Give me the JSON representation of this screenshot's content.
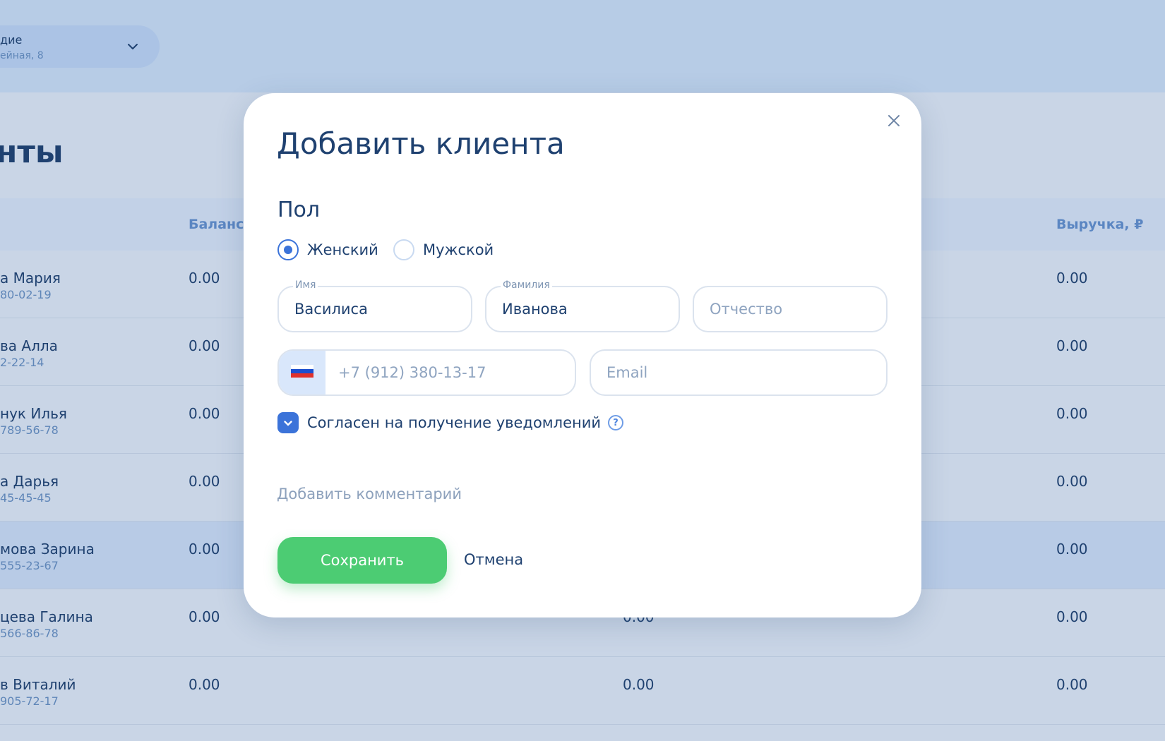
{
  "colors": {
    "accent": "#3b73d9",
    "success": "#4ccc73",
    "text_primary": "#1f4170",
    "text_muted": "#8fa4c0",
    "overlay_bg": "#c9d5e6"
  },
  "background": {
    "location": {
      "name": "дие",
      "address": "ейная, 8",
      "icon": "chevron-down-icon"
    },
    "page_title": "нты",
    "table": {
      "headers": {
        "balance": "Баланс",
        "revenue": "Выручка, ₽"
      },
      "rows": [
        {
          "name": "а Мария",
          "phone": "80-02-19",
          "balance": "0.00",
          "mid": "",
          "revenue": "0.00"
        },
        {
          "name": "ва Алла",
          "phone": "2-22-14",
          "balance": "0.00",
          "mid": "",
          "revenue": "0.00"
        },
        {
          "name": "нук Илья",
          "phone": "789-56-78",
          "balance": "0.00",
          "mid": "",
          "revenue": "0.00"
        },
        {
          "name": "а Дарья",
          "phone": "45-45-45",
          "balance": "0.00",
          "mid": "",
          "revenue": "0.00"
        },
        {
          "name": "мова Зарина",
          "phone": "555-23-67",
          "balance": "0.00",
          "mid": "",
          "revenue": "0.00"
        },
        {
          "name": "цева Галина",
          "phone": "566-86-78",
          "balance": "0.00",
          "mid": "0.00",
          "revenue": "0.00"
        },
        {
          "name": "в Виталий",
          "phone": "905-72-17",
          "balance": "0.00",
          "mid": "0.00",
          "revenue": "0.00"
        }
      ]
    }
  },
  "modal": {
    "title": "Добавить клиента",
    "close_icon": "close-icon",
    "gender": {
      "label": "Пол",
      "options": [
        {
          "label": "Женский",
          "checked": true
        },
        {
          "label": "Мужской",
          "checked": false
        }
      ]
    },
    "fields": {
      "first_name": {
        "label": "Имя",
        "value": "Василиса",
        "placeholder": ""
      },
      "last_name": {
        "label": "Фамилия",
        "value": "Иванова",
        "placeholder": ""
      },
      "middle_name": {
        "label": "",
        "value": "",
        "placeholder": "Отчество"
      },
      "phone": {
        "value": "",
        "placeholder": "+7 (912) 380-13-17",
        "country_icon": "russia-flag-icon"
      },
      "email": {
        "value": "",
        "placeholder": "Email"
      }
    },
    "consent": {
      "label": "Согласен на получение уведомлений",
      "checked": true,
      "help_icon": "question-icon",
      "help_glyph": "?"
    },
    "add_comment": "Добавить комментарий",
    "buttons": {
      "save": "Сохранить",
      "cancel": "Отмена"
    }
  }
}
